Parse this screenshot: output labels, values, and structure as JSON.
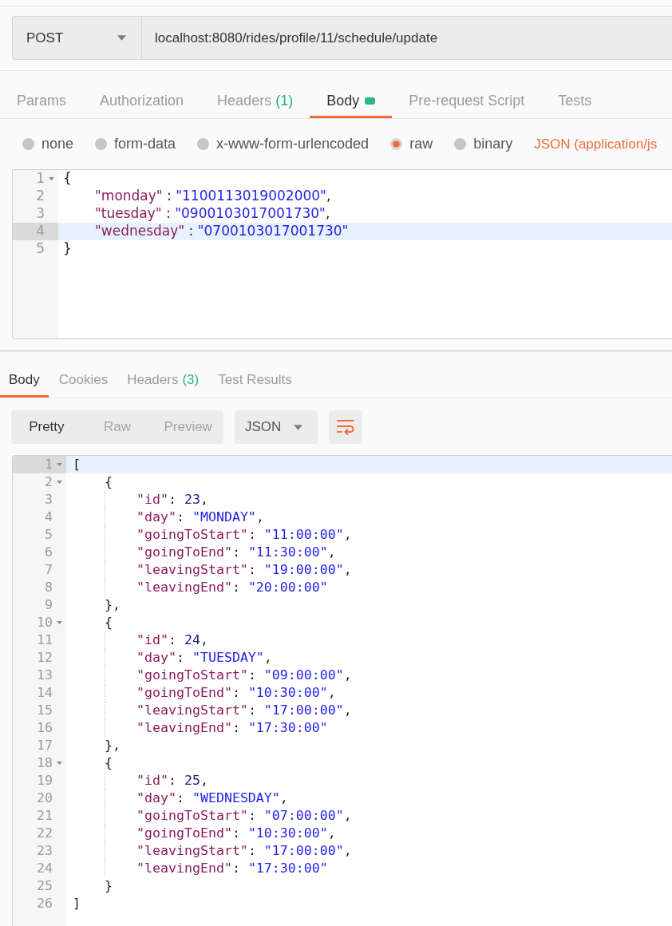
{
  "request": {
    "method": "POST",
    "url": "localhost:8080/rides/profile/11/schedule/update"
  },
  "request_tabs": [
    {
      "label": "Params",
      "selected": false,
      "dot": false
    },
    {
      "label": "Authorization",
      "selected": false,
      "dot": false
    },
    {
      "label": "Headers",
      "count": "(1)",
      "selected": false,
      "dot": false
    },
    {
      "label": "Body",
      "selected": true,
      "dot": true
    },
    {
      "label": "Pre-request Script",
      "selected": false,
      "dot": false
    },
    {
      "label": "Tests",
      "selected": false,
      "dot": false
    }
  ],
  "body_types": [
    {
      "label": "none",
      "selected": false
    },
    {
      "label": "form-data",
      "selected": false
    },
    {
      "label": "x-www-form-urlencoded",
      "selected": false
    },
    {
      "label": "raw",
      "selected": true
    },
    {
      "label": "binary",
      "selected": false
    }
  ],
  "content_type": "JSON (application/js",
  "request_body": {
    "lines": [
      {
        "number": "1",
        "active": false,
        "tokens": [
          {
            "kind": "punct",
            "text": "{"
          }
        ],
        "children": [
          {
            "number": "2",
            "active": false,
            "tokens": [
              {
                "kind": "key",
                "text": "\"monday\""
              },
              {
                "kind": "punct",
                "text": " : "
              },
              {
                "kind": "string",
                "text": "\"1100113019002000\""
              },
              {
                "kind": "punct",
                "text": ","
              }
            ]
          },
          {
            "number": "3",
            "active": false,
            "tokens": [
              {
                "kind": "key",
                "text": "\"tuesday\""
              },
              {
                "kind": "punct",
                "text": " : "
              },
              {
                "kind": "string",
                "text": "\"0900103017001730\""
              },
              {
                "kind": "punct",
                "text": ","
              }
            ]
          },
          {
            "number": "4",
            "active": true,
            "tokens": [
              {
                "kind": "key",
                "text": "\"wednesday\""
              },
              {
                "kind": "punct",
                "text": " : "
              },
              {
                "kind": "string",
                "text": "\"0700103017001730\""
              }
            ]
          }
        ]
      },
      {
        "number": "5",
        "active": false,
        "tokens": [
          {
            "kind": "punct",
            "text": "}"
          }
        ]
      }
    ]
  },
  "response_tabs": [
    {
      "label": "Body",
      "selected": true
    },
    {
      "label": "Cookies",
      "selected": false
    },
    {
      "label": "Headers",
      "count": "(3)",
      "selected": false
    },
    {
      "label": "Test Results",
      "selected": false
    }
  ],
  "view_modes": [
    {
      "label": "Pretty",
      "selected": true
    },
    {
      "label": "Raw",
      "selected": false
    },
    {
      "label": "Preview",
      "selected": false
    }
  ],
  "format": "JSON",
  "response_body": {
    "lines": [
      {
        "number": "1",
        "active": true,
        "tokens": [
          {
            "kind": "punct",
            "text": "["
          }
        ],
        "children": [
          {
            "number": "2",
            "active": false,
            "tokens": [
              {
                "kind": "punct",
                "text": "{"
              }
            ],
            "children": [
              {
                "number": "3",
                "active": false,
                "tokens": [
                  {
                    "kind": "key",
                    "text": "\"id\""
                  },
                  {
                    "kind": "punct",
                    "text": ": "
                  },
                  {
                    "kind": "number",
                    "text": "23"
                  },
                  {
                    "kind": "punct",
                    "text": ","
                  }
                ]
              },
              {
                "number": "4",
                "active": false,
                "tokens": [
                  {
                    "kind": "key",
                    "text": "\"day\""
                  },
                  {
                    "kind": "punct",
                    "text": ": "
                  },
                  {
                    "kind": "string",
                    "text": "\"MONDAY\""
                  },
                  {
                    "kind": "punct",
                    "text": ","
                  }
                ]
              },
              {
                "number": "5",
                "active": false,
                "tokens": [
                  {
                    "kind": "key",
                    "text": "\"goingToStart\""
                  },
                  {
                    "kind": "punct",
                    "text": ": "
                  },
                  {
                    "kind": "string",
                    "text": "\"11:00:00\""
                  },
                  {
                    "kind": "punct",
                    "text": ","
                  }
                ]
              },
              {
                "number": "6",
                "active": false,
                "tokens": [
                  {
                    "kind": "key",
                    "text": "\"goingToEnd\""
                  },
                  {
                    "kind": "punct",
                    "text": ": "
                  },
                  {
                    "kind": "string",
                    "text": "\"11:30:00\""
                  },
                  {
                    "kind": "punct",
                    "text": ","
                  }
                ]
              },
              {
                "number": "7",
                "active": false,
                "tokens": [
                  {
                    "kind": "key",
                    "text": "\"leavingStart\""
                  },
                  {
                    "kind": "punct",
                    "text": ": "
                  },
                  {
                    "kind": "string",
                    "text": "\"19:00:00\""
                  },
                  {
                    "kind": "punct",
                    "text": ","
                  }
                ]
              },
              {
                "number": "8",
                "active": false,
                "tokens": [
                  {
                    "kind": "key",
                    "text": "\"leavingEnd\""
                  },
                  {
                    "kind": "punct",
                    "text": ": "
                  },
                  {
                    "kind": "string",
                    "text": "\"20:00:00\""
                  }
                ]
              }
            ]
          },
          {
            "number": "9",
            "active": false,
            "tokens": [
              {
                "kind": "punct",
                "text": "},"
              }
            ]
          },
          {
            "number": "10",
            "active": false,
            "tokens": [
              {
                "kind": "punct",
                "text": "{"
              }
            ],
            "children": [
              {
                "number": "11",
                "active": false,
                "tokens": [
                  {
                    "kind": "key",
                    "text": "\"id\""
                  },
                  {
                    "kind": "punct",
                    "text": ": "
                  },
                  {
                    "kind": "number",
                    "text": "24"
                  },
                  {
                    "kind": "punct",
                    "text": ","
                  }
                ]
              },
              {
                "number": "12",
                "active": false,
                "tokens": [
                  {
                    "kind": "key",
                    "text": "\"day\""
                  },
                  {
                    "kind": "punct",
                    "text": ": "
                  },
                  {
                    "kind": "string",
                    "text": "\"TUESDAY\""
                  },
                  {
                    "kind": "punct",
                    "text": ","
                  }
                ]
              },
              {
                "number": "13",
                "active": false,
                "tokens": [
                  {
                    "kind": "key",
                    "text": "\"goingToStart\""
                  },
                  {
                    "kind": "punct",
                    "text": ": "
                  },
                  {
                    "kind": "string",
                    "text": "\"09:00:00\""
                  },
                  {
                    "kind": "punct",
                    "text": ","
                  }
                ]
              },
              {
                "number": "14",
                "active": false,
                "tokens": [
                  {
                    "kind": "key",
                    "text": "\"goingToEnd\""
                  },
                  {
                    "kind": "punct",
                    "text": ": "
                  },
                  {
                    "kind": "string",
                    "text": "\"10:30:00\""
                  },
                  {
                    "kind": "punct",
                    "text": ","
                  }
                ]
              },
              {
                "number": "15",
                "active": false,
                "tokens": [
                  {
                    "kind": "key",
                    "text": "\"leavingStart\""
                  },
                  {
                    "kind": "punct",
                    "text": ": "
                  },
                  {
                    "kind": "string",
                    "text": "\"17:00:00\""
                  },
                  {
                    "kind": "punct",
                    "text": ","
                  }
                ]
              },
              {
                "number": "16",
                "active": false,
                "tokens": [
                  {
                    "kind": "key",
                    "text": "\"leavingEnd\""
                  },
                  {
                    "kind": "punct",
                    "text": ": "
                  },
                  {
                    "kind": "string",
                    "text": "\"17:30:00\""
                  }
                ]
              }
            ]
          },
          {
            "number": "17",
            "active": false,
            "tokens": [
              {
                "kind": "punct",
                "text": "},"
              }
            ]
          },
          {
            "number": "18",
            "active": false,
            "tokens": [
              {
                "kind": "punct",
                "text": "{"
              }
            ],
            "children": [
              {
                "number": "19",
                "active": false,
                "tokens": [
                  {
                    "kind": "key",
                    "text": "\"id\""
                  },
                  {
                    "kind": "punct",
                    "text": ": "
                  },
                  {
                    "kind": "number",
                    "text": "25"
                  },
                  {
                    "kind": "punct",
                    "text": ","
                  }
                ]
              },
              {
                "number": "20",
                "active": false,
                "tokens": [
                  {
                    "kind": "key",
                    "text": "\"day\""
                  },
                  {
                    "kind": "punct",
                    "text": ": "
                  },
                  {
                    "kind": "string",
                    "text": "\"WEDNESDAY\""
                  },
                  {
                    "kind": "punct",
                    "text": ","
                  }
                ]
              },
              {
                "number": "21",
                "active": false,
                "tokens": [
                  {
                    "kind": "key",
                    "text": "\"goingToStart\""
                  },
                  {
                    "kind": "punct",
                    "text": ": "
                  },
                  {
                    "kind": "string",
                    "text": "\"07:00:00\""
                  },
                  {
                    "kind": "punct",
                    "text": ","
                  }
                ]
              },
              {
                "number": "22",
                "active": false,
                "tokens": [
                  {
                    "kind": "key",
                    "text": "\"goingToEnd\""
                  },
                  {
                    "kind": "punct",
                    "text": ": "
                  },
                  {
                    "kind": "string",
                    "text": "\"10:30:00\""
                  },
                  {
                    "kind": "punct",
                    "text": ","
                  }
                ]
              },
              {
                "number": "23",
                "active": false,
                "tokens": [
                  {
                    "kind": "key",
                    "text": "\"leavingStart\""
                  },
                  {
                    "kind": "punct",
                    "text": ": "
                  },
                  {
                    "kind": "string",
                    "text": "\"17:00:00\""
                  },
                  {
                    "kind": "punct",
                    "text": ","
                  }
                ]
              },
              {
                "number": "24",
                "active": false,
                "tokens": [
                  {
                    "kind": "key",
                    "text": "\"leavingEnd\""
                  },
                  {
                    "kind": "punct",
                    "text": ": "
                  },
                  {
                    "kind": "string",
                    "text": "\"17:30:00\""
                  }
                ]
              }
            ]
          },
          {
            "number": "25",
            "active": false,
            "tokens": [
              {
                "kind": "punct",
                "text": "}"
              }
            ]
          }
        ]
      },
      {
        "number": "26",
        "active": false,
        "tokens": [
          {
            "kind": "punct",
            "text": "]"
          }
        ]
      }
    ]
  }
}
